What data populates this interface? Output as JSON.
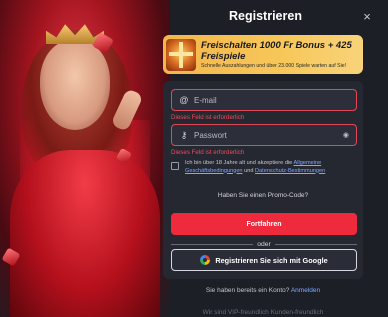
{
  "modal": {
    "title": "Registrieren",
    "close_icon": "×"
  },
  "promo": {
    "title": "Freischalten 1000 Fr Bonus + 425 Freispiele",
    "subtitle": "Schnelle Auszahlungen und über 23.000 Spiele warten auf Sie!"
  },
  "form": {
    "email_placeholder": "E-mail",
    "email_error": "Dieses Feld ist erforderlich",
    "password_placeholder": "Passwort",
    "password_error": "Dieses Feld ist erforderlich",
    "terms_prefix": "Ich bin über 18 Jahre alt und akzeptiere die ",
    "terms_link1": "Allgemeine Geschäftsbedingungen",
    "terms_and": " und ",
    "terms_link2": "Datenschutz-Bestimmungen",
    "promo_code": "Haben Sie einen Promo-Code?",
    "submit_label": "Fortfahren",
    "or_label": "oder",
    "google_label": "Registrieren Sie sich mit Google"
  },
  "footer": {
    "login_prompt": "Sie haben bereits ein Konto?",
    "login_link": "Anmelden",
    "hint": "Wir sind VIP-freundlich     Kunden-freundlich"
  },
  "colors": {
    "accent": "#ef2a3c",
    "error": "#ef4c5a",
    "promo_bg": "#f4b64a",
    "link": "#7fa8ff"
  }
}
